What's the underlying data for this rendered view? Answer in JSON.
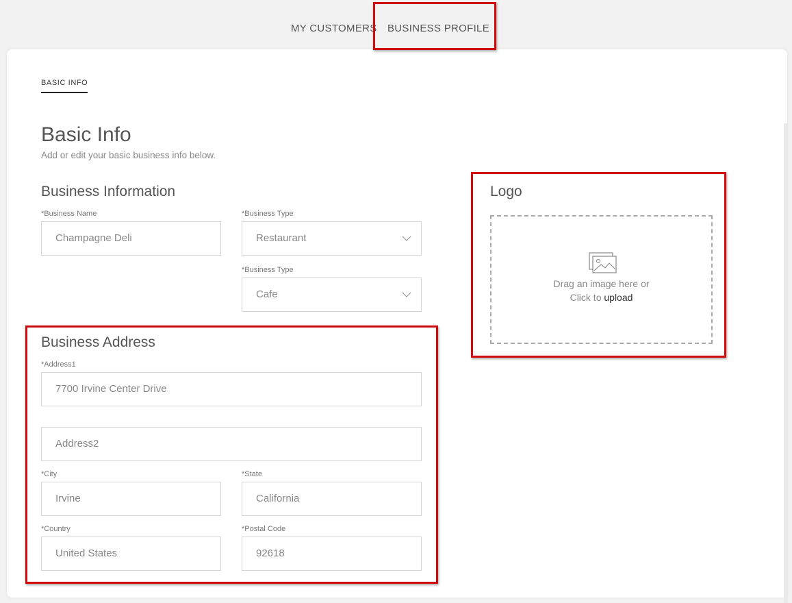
{
  "topnav": {
    "tabs": [
      {
        "label": "MY CUSTOMERS"
      },
      {
        "label": "BUSINESS PROFILE"
      }
    ]
  },
  "subtab": {
    "label": "BASIC INFO"
  },
  "page": {
    "title": "Basic Info",
    "subtitle": "Add or edit your basic business info below."
  },
  "business_info": {
    "title": "Business Information",
    "business_name": {
      "label": "*Business Name",
      "value": "Champagne Deli"
    },
    "business_type": {
      "label": "*Business Type",
      "value": "Restaurant"
    },
    "business_subtype": {
      "label": "*Business Type",
      "value": "Cafe"
    }
  },
  "business_address": {
    "title": "Business Address",
    "address1": {
      "label": "*Address1",
      "value": "7700 Irvine Center Drive"
    },
    "address2": {
      "placeholder": "Address2"
    },
    "city": {
      "label": "*City",
      "value": "Irvine"
    },
    "state": {
      "label": "*State",
      "value": "California"
    },
    "country": {
      "label": "*Country",
      "value": "United States"
    },
    "postal_code": {
      "label": "*Postal Code",
      "value": "92618"
    }
  },
  "logo": {
    "title": "Logo",
    "drop_text": "Drag an image here or",
    "click_text": "Click to ",
    "upload_text": "upload",
    "icon": "image-icon"
  },
  "colors": {
    "highlight": "#d10a0a",
    "card_bg": "#ffffff",
    "page_bg": "#f2f2f2"
  }
}
